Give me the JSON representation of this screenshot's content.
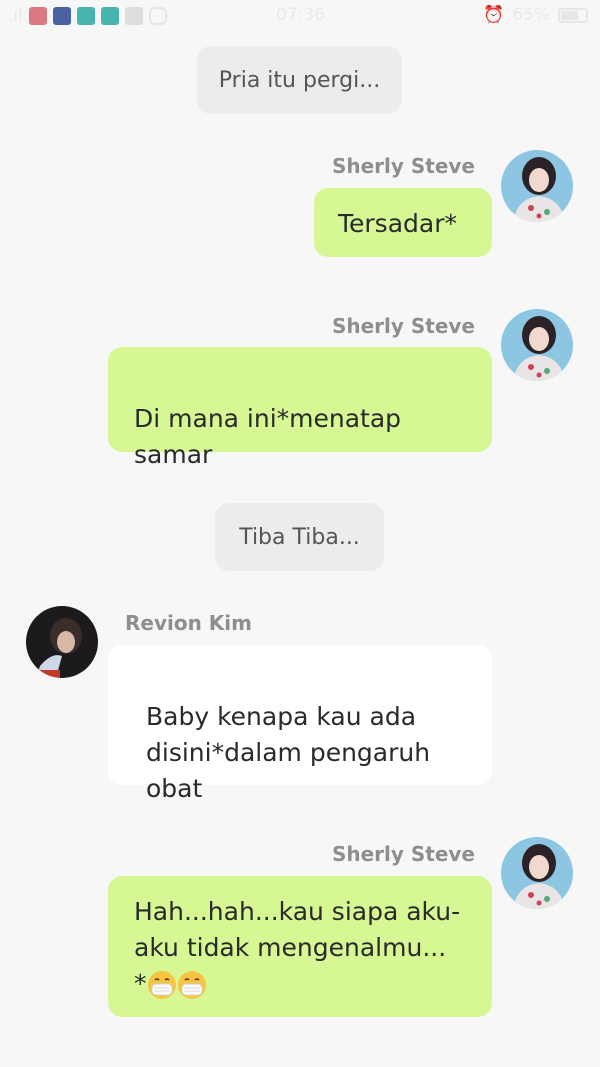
{
  "status_bar": {
    "time": "07:36",
    "battery": "65%"
  },
  "messages": [
    {
      "kind": "narration",
      "text": "Pria itu pergi..."
    },
    {
      "kind": "message",
      "side": "right",
      "sender": "Sherly Steve",
      "text": "Tersadar*"
    },
    {
      "kind": "message",
      "side": "right",
      "sender": "Sherly Steve",
      "text": "Di mana ini*menatap\nsamar"
    },
    {
      "kind": "narration",
      "text": "Tiba Tiba..."
    },
    {
      "kind": "message",
      "side": "left",
      "sender": "Revion Kim",
      "text": "Baby kenapa kau ada\ndisini*dalam pengaruh\nobat"
    },
    {
      "kind": "message",
      "side": "right",
      "sender": "Sherly Steve",
      "text": "Hah...hah...kau siapa aku-\naku tidak mengenalmu...",
      "suffix": "*",
      "emoji": [
        "face-with-medical-mask",
        "face-with-medical-mask"
      ]
    }
  ],
  "icons": {
    "avatar_sherly": "sherly-steve-avatar",
    "avatar_revion": "revion-kim-avatar"
  }
}
